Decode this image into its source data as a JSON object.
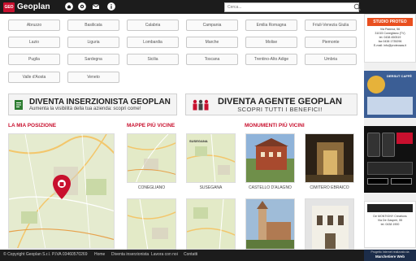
{
  "header": {
    "logo_mark": "GEO",
    "logo_text": "Geoplan",
    "search_placeholder": "Cerca..."
  },
  "regions": [
    "Abruzzo",
    "Basilicata",
    "Calabria",
    "Campania",
    "Emilia Romagna",
    "Friuli-Venezia Giulia",
    "Lazio",
    "Liguria",
    "Lombardia",
    "Marche",
    "Molise",
    "Piemonte",
    "Puglia",
    "Sardegna",
    "Sicilia",
    "Toscana",
    "Trentino-Alto Adige",
    "Umbria",
    "Valle d'Aosta",
    "Veneto"
  ],
  "banners": {
    "left_title": "DIVENTA INSERZIONISTA GEOPLAN",
    "left_sub": "Aumenta la visibilità della tua azienda: scopri come!",
    "right_title": "DIVENTA AGENTE GEOPLAN",
    "right_sub": "SCOPRI TUTTI I BENEFICI!"
  },
  "sections": {
    "position": "LA MIA POSIZIONE",
    "maps": "MAPPE PIÙ VICINE",
    "monuments": "MONUMENTI PIÙ VICINI"
  },
  "maps": [
    "CONEGLIANO",
    "SUSEGANA",
    "",
    ""
  ],
  "map_label_susegana": "SUSEGANA",
  "monuments": [
    "CASTELLO D'ALAGNO",
    "CIMITERO EBRAICO",
    "",
    ""
  ],
  "ads": {
    "studio_title": "STUDIO PROTEO",
    "studio_lines": [
      "Via Padova, 56",
      "31015 Conegliano (TV)",
      "tel. 0438 450519",
      "fax 0438 1735296",
      "E-mail: info@proteosas.it"
    ],
    "ad2_title": "DERSUT CAFFÈ",
    "ad4_lines": [
      "De MONTIGNY Creations",
      "Via De Gasperi, 55",
      "tel. 0438 1900"
    ],
    "bottom_title": "Progetto Internet realizzato da",
    "bottom_brand": "Marchetiere Web"
  },
  "footer": {
    "copyright": "© Copyright Geoplan S.r.l.",
    "vat": "P.IVA 03460570269",
    "links": [
      "Home",
      "Diventa inserzionista",
      "Lavora con noi",
      "Contatti"
    ]
  },
  "colors": {
    "topbar": "#1c1c1c",
    "accent_red": "#c8102e",
    "map_green": "#e8edd5"
  }
}
